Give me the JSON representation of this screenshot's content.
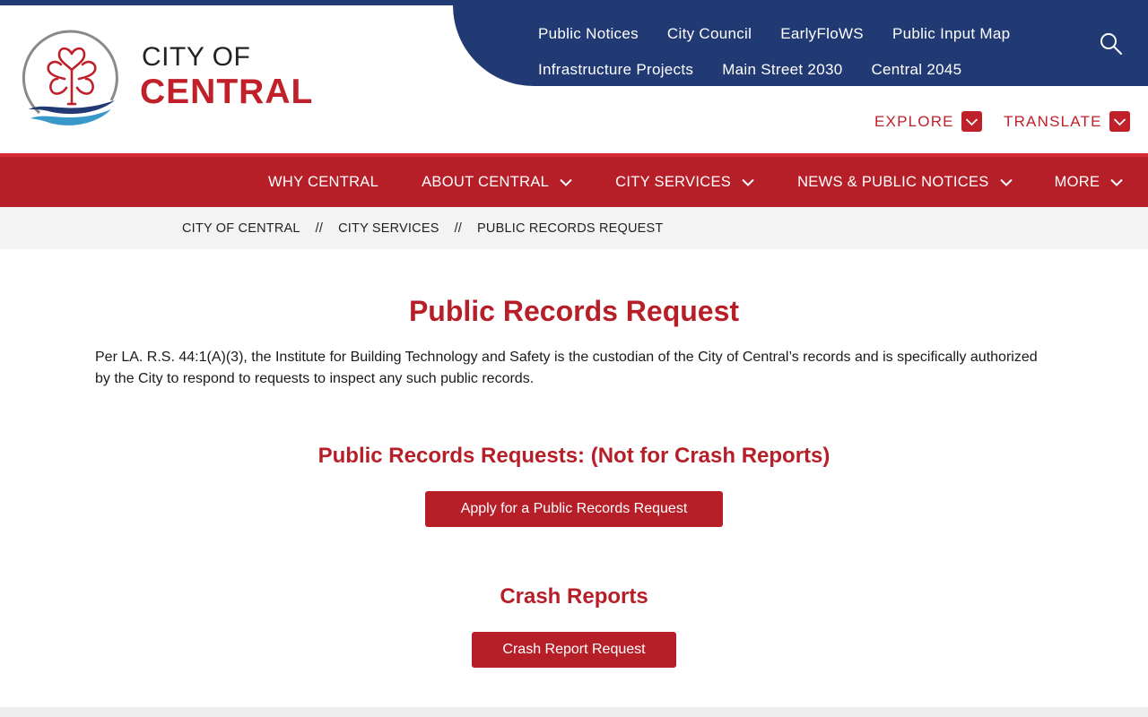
{
  "site": {
    "logo_line1": "CITY OF",
    "logo_line2": "CENTRAL"
  },
  "utility_nav": {
    "row1": [
      "Public Notices",
      "City Council",
      "EarlyFloWS",
      "Public Input Map"
    ],
    "row2": [
      "Infrastructure Projects",
      "Main Street 2030",
      "Central 2045"
    ]
  },
  "dropdowns": {
    "explore": "EXPLORE",
    "translate": "TRANSLATE"
  },
  "main_nav": {
    "why": "WHY CENTRAL",
    "about": "ABOUT CENTRAL",
    "services": "CITY SERVICES",
    "news": "NEWS & PUBLIC NOTICES",
    "more": "MORE"
  },
  "breadcrumb": {
    "home": "CITY OF CENTRAL",
    "separator": "//",
    "section": "CITY SERVICES",
    "current": "PUBLIC RECORDS REQUEST"
  },
  "content": {
    "title": "Public Records Request",
    "intro": "Per LA. R.S. 44:1(A)(3), the Institute for Building Technology and Safety is the custodian of the City of Central’s records and is specifically authorized by the City to respond to requests to inspect any such public records.",
    "section1_heading": "Public Records Requests: (Not for Crash Reports)",
    "section1_button": "Apply for a Public Records Request",
    "section2_heading": "Crash Reports",
    "section2_button": "Crash Report Request"
  },
  "colors": {
    "brand_red": "#b71f28",
    "brand_blue": "#223a73"
  },
  "icons": [
    "city-emblem-icon",
    "search-icon",
    "chevron-down-icon"
  ]
}
